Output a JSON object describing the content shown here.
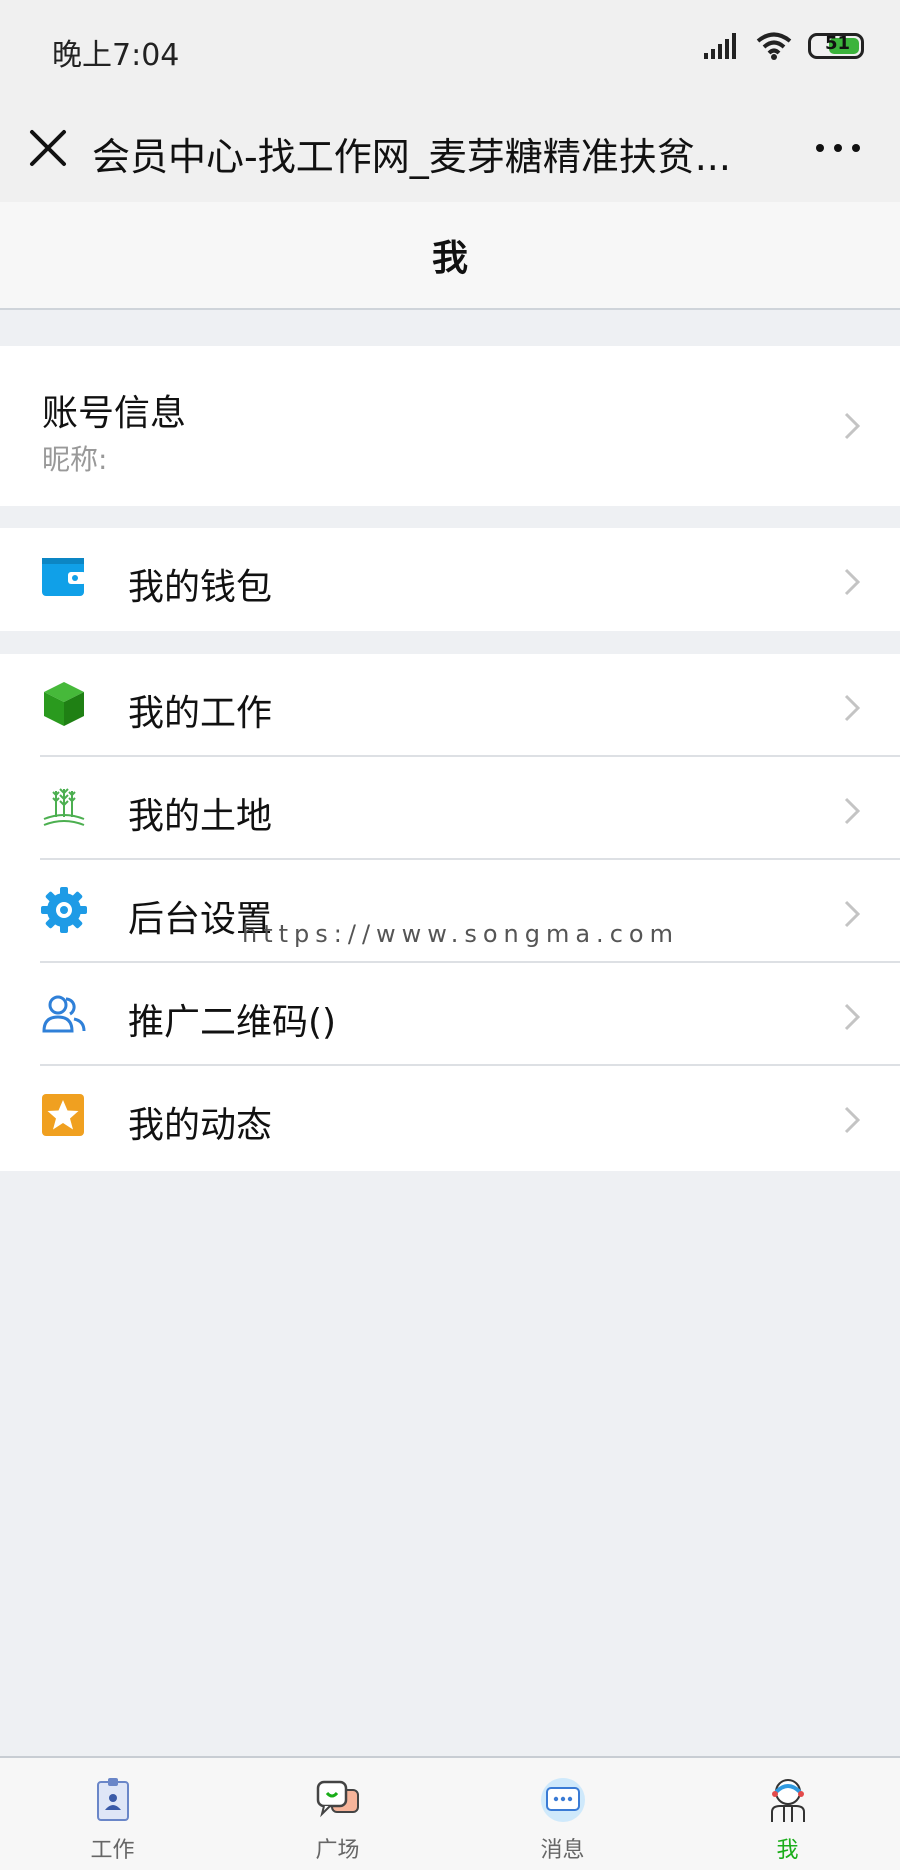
{
  "status": {
    "time": "晚上7:04",
    "battery": "51"
  },
  "nav": {
    "title": "会员中心-找工作网_麦芽糖精准扶贫..."
  },
  "page": {
    "title": "我"
  },
  "account": {
    "title": "账号信息",
    "nickname_label": "昵称:"
  },
  "menu": [
    {
      "label": "我的钱包",
      "icon": "wallet-icon",
      "color": "#10a0e8"
    },
    {
      "label": "我的工作",
      "icon": "cube-icon",
      "color": "#2ea01e"
    },
    {
      "label": "我的土地",
      "icon": "wheat-icon",
      "color": "#4caf50"
    },
    {
      "label": "后台设置",
      "icon": "gear-icon",
      "color": "#1e9be6"
    },
    {
      "label": "推广二维码()",
      "icon": "users-icon",
      "color": "#2f80d8"
    },
    {
      "label": "我的动态",
      "icon": "star-icon",
      "color": "#f0a020"
    }
  ],
  "watermark": "https://www.songma.com",
  "tabs": [
    {
      "label": "工作",
      "icon": "badge-icon"
    },
    {
      "label": "广场",
      "icon": "chat-icon"
    },
    {
      "label": "消息",
      "icon": "message-icon"
    },
    {
      "label": "我",
      "icon": "profile-icon",
      "active": true
    }
  ],
  "colors": {
    "accent": "#1aad19",
    "background": "#eef0f3"
  }
}
